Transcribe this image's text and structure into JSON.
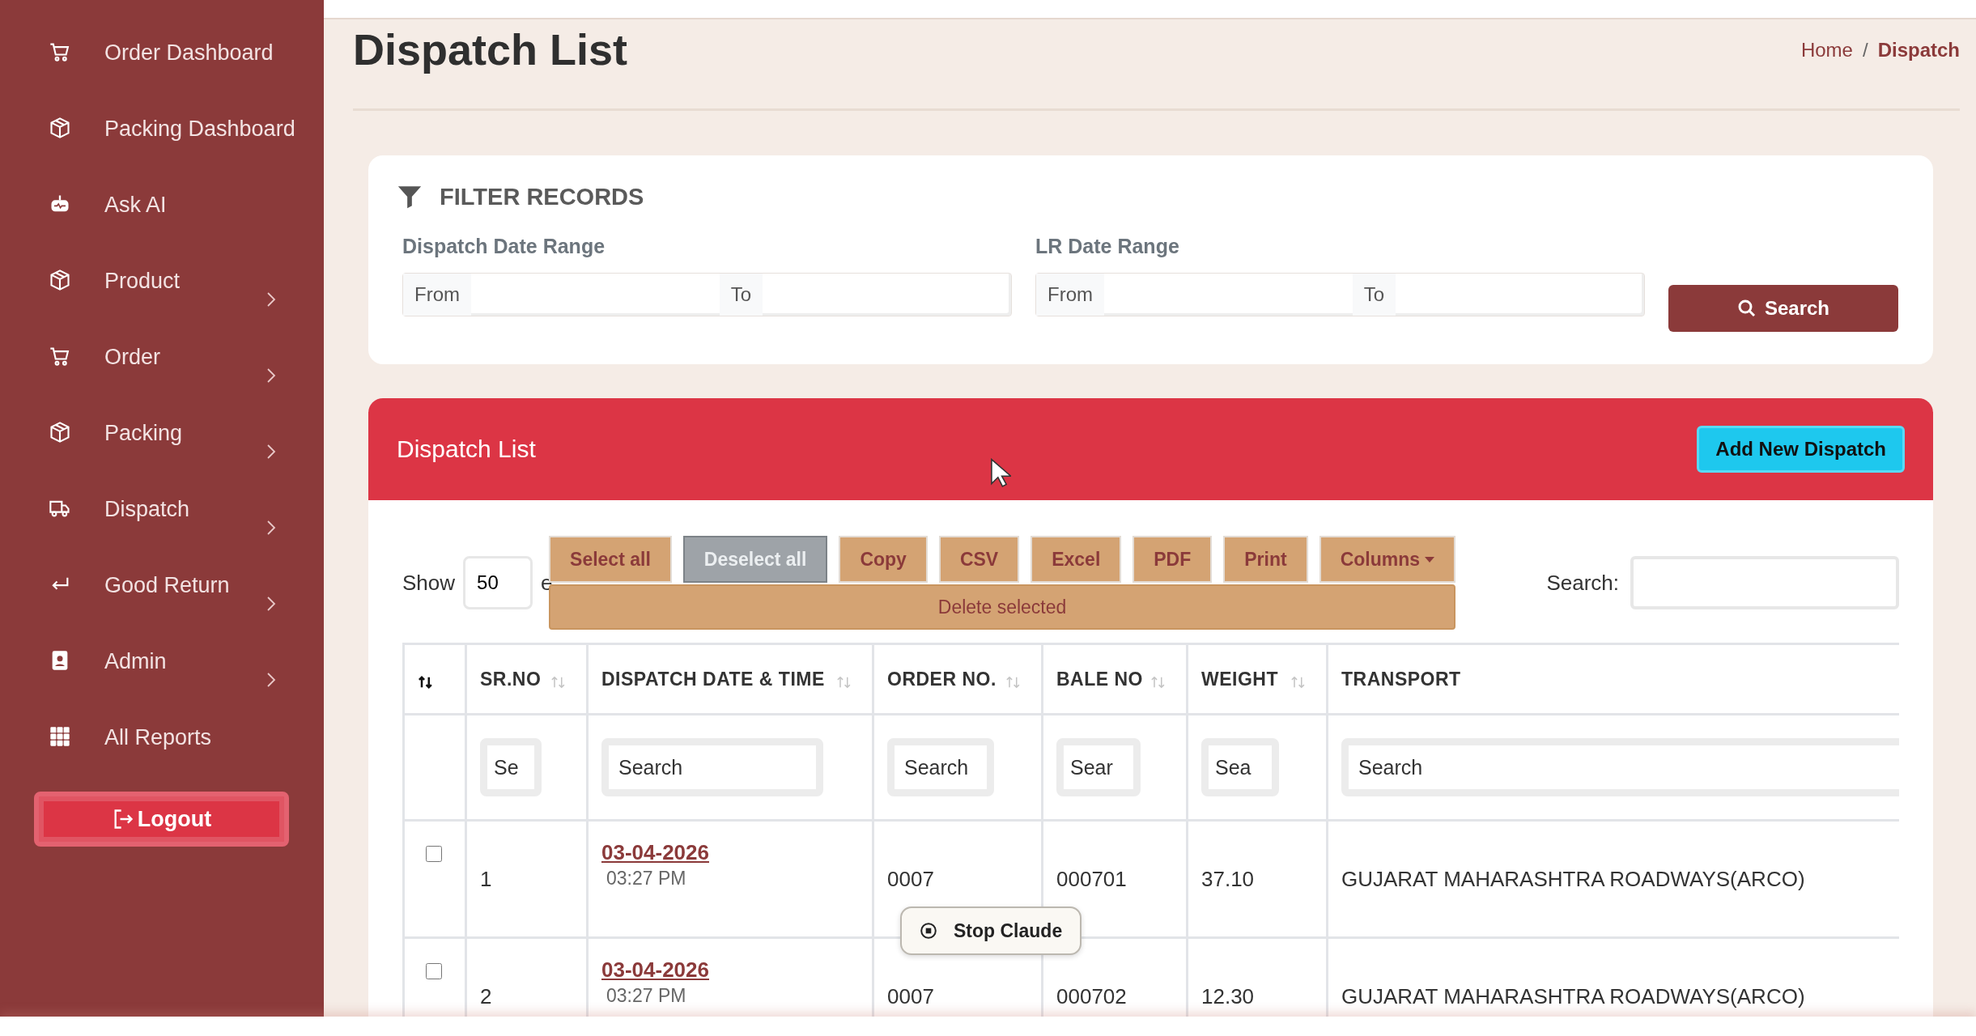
{
  "sidebar": {
    "items": [
      {
        "label": "Order Dashboard",
        "kind": "cart",
        "expandable": false
      },
      {
        "label": "Packing Dashboard",
        "kind": "box",
        "expandable": false
      },
      {
        "label": "Ask AI",
        "kind": "robot",
        "expandable": false
      },
      {
        "label": "Product",
        "kind": "box",
        "expandable": true
      },
      {
        "label": "Order",
        "kind": "cart",
        "expandable": true
      },
      {
        "label": "Packing",
        "kind": "box",
        "expandable": true
      },
      {
        "label": "Dispatch",
        "kind": "truck",
        "expandable": true
      },
      {
        "label": "Good Return",
        "kind": "return",
        "expandable": true
      },
      {
        "label": "Admin",
        "kind": "badge",
        "expandable": true
      },
      {
        "label": "All Reports",
        "kind": "grid",
        "expandable": false
      }
    ],
    "logout": "Logout"
  },
  "page": {
    "title": "Dispatch List",
    "breadcrumb": [
      {
        "label": "Home",
        "selected": false
      },
      {
        "label": "Dispatch",
        "selected": true
      }
    ],
    "separator": "/"
  },
  "filter": {
    "title": "FILTER RECORDS",
    "ranges": [
      {
        "label": "Dispatch Date Range",
        "from": "From",
        "to": "To"
      },
      {
        "label": "LR Date Range",
        "from": "From",
        "to": "To"
      }
    ],
    "search_button": "Search"
  },
  "list": {
    "title": "Dispatch List",
    "add_button": "Add New Dispatch",
    "show_label": "Show",
    "page_size": "50",
    "entries_fragment": "e",
    "buttons": [
      {
        "label": "Select all",
        "disabled": false,
        "kind": "plain"
      },
      {
        "label": "Deselect all",
        "disabled": true,
        "kind": "plain"
      },
      {
        "label": "Copy",
        "disabled": false,
        "kind": "plain"
      },
      {
        "label": "CSV",
        "disabled": false,
        "kind": "plain"
      },
      {
        "label": "Excel",
        "disabled": false,
        "kind": "plain"
      },
      {
        "label": "PDF",
        "disabled": false,
        "kind": "plain"
      },
      {
        "label": "Print",
        "disabled": false,
        "kind": "plain"
      },
      {
        "label": "Columns",
        "disabled": false,
        "kind": "dropdown"
      }
    ],
    "delete_button": "Delete selected",
    "search_label": "Search:"
  },
  "table": {
    "columns": [
      {
        "kind": "select",
        "sortable": true,
        "sorted": true
      },
      {
        "kind": "text",
        "label": "SR.NO",
        "sortable": true,
        "sorted": false,
        "placeholder": "Se"
      },
      {
        "kind": "text",
        "label": "DISPATCH DATE & TIME",
        "sortable": true,
        "sorted": false,
        "placeholder": "Search"
      },
      {
        "kind": "text",
        "label": "ORDER NO.",
        "sortable": true,
        "sorted": false,
        "placeholder": "Search"
      },
      {
        "kind": "text",
        "label": "BALE NO",
        "sortable": true,
        "sorted": false,
        "placeholder": "Sear"
      },
      {
        "kind": "text",
        "label": "WEIGHT",
        "sortable": true,
        "sorted": false,
        "placeholder": "Sea"
      },
      {
        "kind": "text",
        "label": "TRANSPORT",
        "sortable": false,
        "placeholder": "Search"
      }
    ],
    "rows": [
      {
        "checked": false,
        "sr": "1",
        "date": "03-04-2026",
        "time": "03:27 PM",
        "order_no": "0007",
        "bale_no": "000701",
        "weight": "37.10",
        "transport": "GUJARAT MAHARASHTRA ROADWAYS(ARCO)"
      },
      {
        "checked": false,
        "sr": "2",
        "date": "03-04-2026",
        "time": "03:27 PM",
        "order_no": "0007",
        "bale_no": "000702",
        "weight": "12.30",
        "transport": "GUJARAT MAHARASHTRA ROADWAYS(ARCO)"
      }
    ]
  },
  "overlay": {
    "stop_button": "Stop Claude"
  }
}
